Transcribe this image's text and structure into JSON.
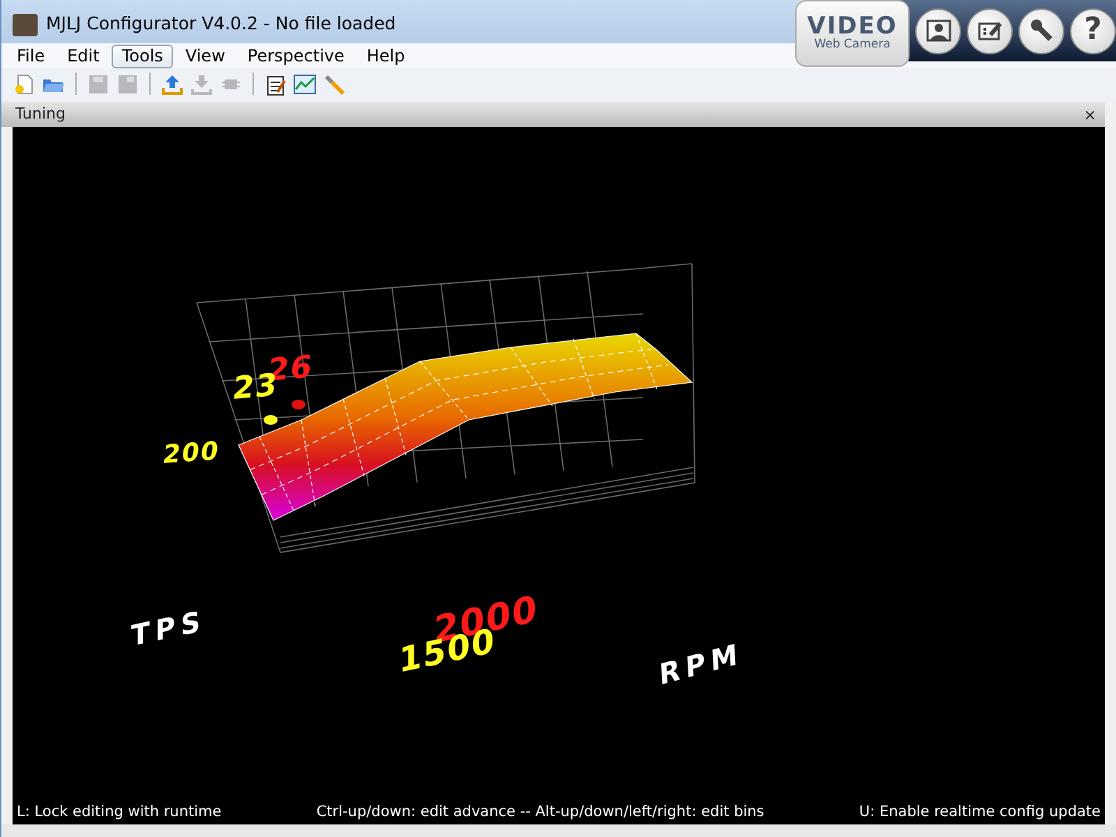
{
  "window": {
    "title": "MJLJ Configurator V4.0.2 - No file loaded"
  },
  "menu": [
    {
      "label": "File",
      "selected": false
    },
    {
      "label": "Edit",
      "selected": false
    },
    {
      "label": "Tools",
      "selected": true
    },
    {
      "label": "View",
      "selected": false
    },
    {
      "label": "Perspective",
      "selected": false
    },
    {
      "label": "Help",
      "selected": false
    }
  ],
  "toolbar": [
    {
      "kind": "new",
      "disabled": false
    },
    {
      "kind": "open",
      "disabled": false
    },
    {
      "kind": "separator"
    },
    {
      "kind": "save",
      "disabled": true
    },
    {
      "kind": "save-all",
      "disabled": true
    },
    {
      "kind": "separator"
    },
    {
      "kind": "upload",
      "disabled": false
    },
    {
      "kind": "download",
      "disabled": true
    },
    {
      "kind": "chip",
      "disabled": true
    },
    {
      "kind": "separator"
    },
    {
      "kind": "clipboard",
      "disabled": false
    },
    {
      "kind": "chart",
      "disabled": false
    },
    {
      "kind": "wrench",
      "disabled": false
    }
  ],
  "video_overlay": {
    "title": "VIDEO",
    "subtitle": "Web Camera",
    "buttons": [
      {
        "kind": "person"
      },
      {
        "kind": "edit"
      },
      {
        "kind": "wrench"
      },
      {
        "kind": "help",
        "label": "?"
      }
    ]
  },
  "panel": {
    "title": "Tuning",
    "close": "×"
  },
  "plot_labels": [
    {
      "text": "26",
      "kind": "value",
      "color": "#ff1a1a"
    },
    {
      "text": "23",
      "kind": "value",
      "color": "#ffff20"
    },
    {
      "text": "200",
      "kind": "value",
      "color": "#ffff20"
    },
    {
      "text": "TPS",
      "kind": "axis",
      "color": "#ffffff"
    },
    {
      "text": "2000",
      "kind": "axis-value",
      "color": "#ff1a1a"
    },
    {
      "text": "1500",
      "kind": "axis-value",
      "color": "#ffff20"
    },
    {
      "text": "RPM",
      "kind": "axis",
      "color": "#ffffff"
    }
  ],
  "markers": [
    {
      "color": "#ffff20"
    },
    {
      "color": "#e01010"
    }
  ],
  "status": [
    "L: Lock editing with runtime",
    "Ctrl-up/down: edit advance -- Alt-up/down/left/right: edit bins",
    "U: Enable realtime config update"
  ]
}
